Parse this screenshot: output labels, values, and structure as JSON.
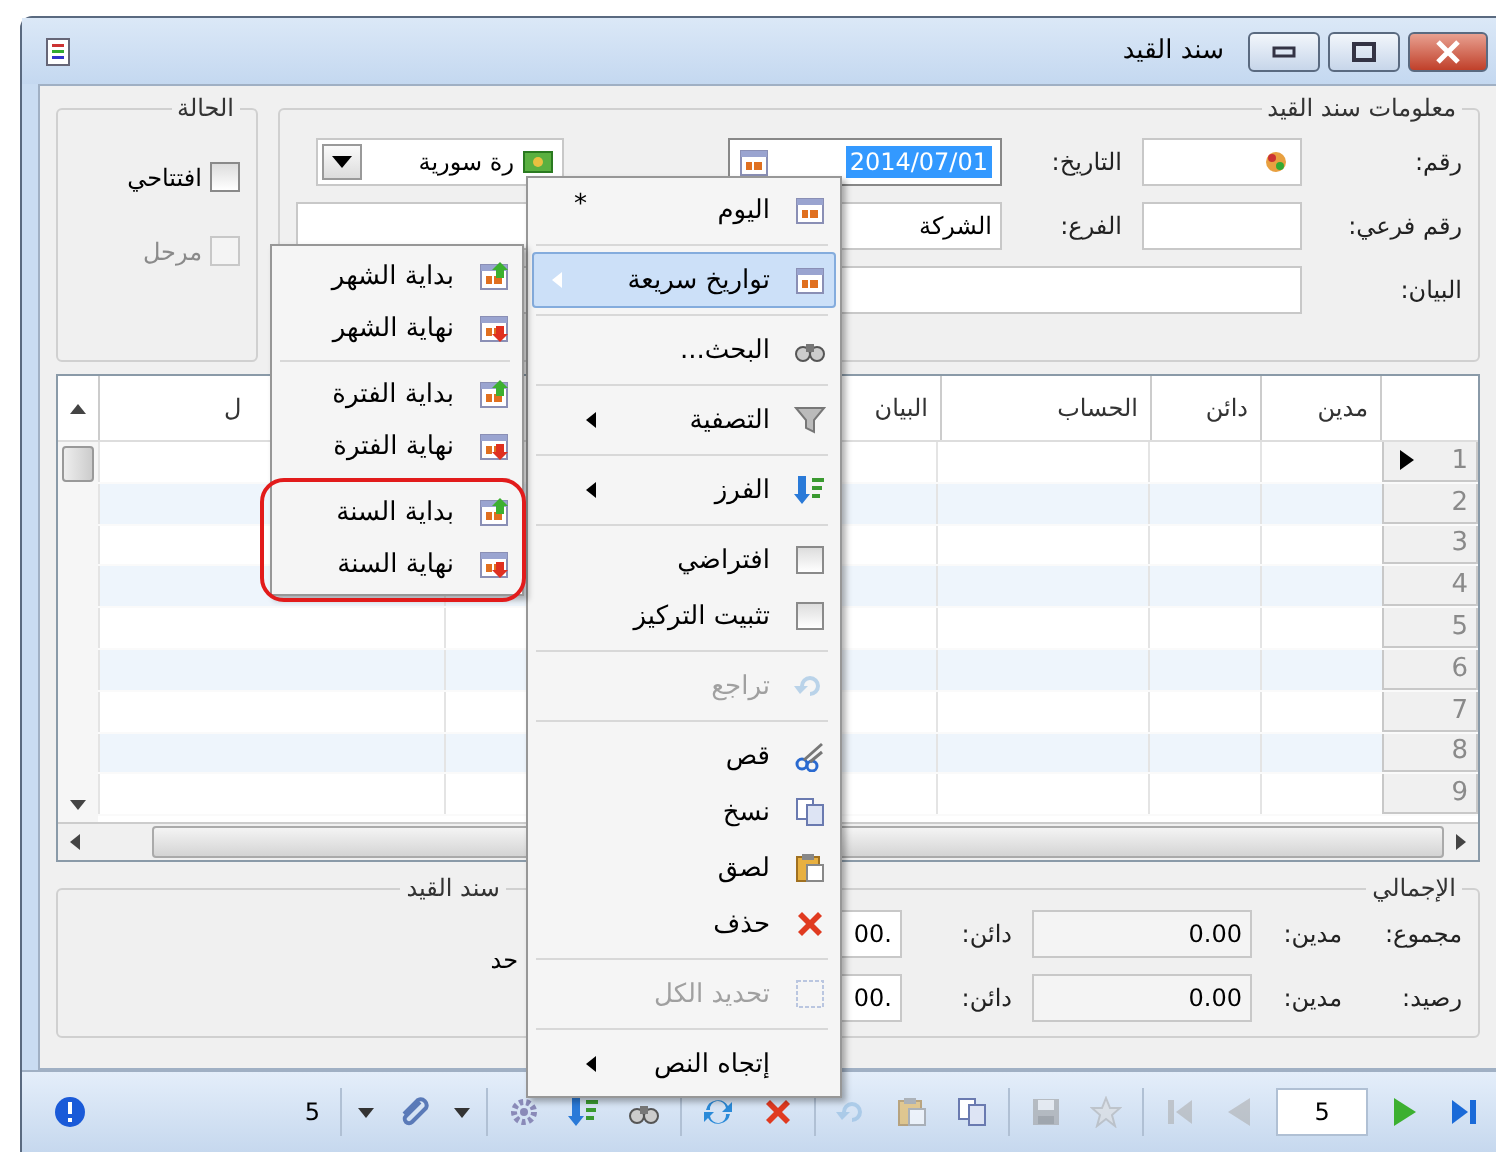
{
  "window": {
    "title": "سند القيد"
  },
  "info_group": {
    "title": "معلومات سند القيد",
    "number_label": "رقم:",
    "date_label": "التاريخ:",
    "date_value": "2014/07/01",
    "date_text_selected": true,
    "currency_value": "رة سورية",
    "sub_number_label": "رقم فرعي:",
    "branch_label": "الفرع:",
    "branch_value": "الشركة",
    "description_label": "البيان:"
  },
  "status_group": {
    "title": "الحالة",
    "checkboxes": [
      {
        "label": "افتتاحي",
        "checked": false,
        "disabled": false
      },
      {
        "label": "مرحل",
        "checked": false,
        "disabled": true
      }
    ]
  },
  "grid": {
    "columns": [
      {
        "label": "مدين"
      },
      {
        "label": "دائن"
      },
      {
        "label": "الحساب"
      },
      {
        "label": "البيان"
      },
      {},
      {
        "label": "ل"
      }
    ],
    "rows": [
      {
        "number": "1",
        "current": true
      },
      {
        "number": "2",
        "current": false
      },
      {
        "number": "3",
        "current": false
      },
      {
        "number": "4",
        "current": false
      },
      {
        "number": "5",
        "current": false
      },
      {
        "number": "6",
        "current": false
      },
      {
        "number": "7",
        "current": false
      },
      {
        "number": "8",
        "current": false
      },
      {
        "number": "9",
        "current": false
      }
    ]
  },
  "totals_group": {
    "title": "الإجمالي",
    "rows": [
      {
        "label": "مجموع:",
        "debit_label": "مدين:",
        "debit_value": "0.00",
        "credit_label": "دائن:",
        "credit_value": ".00"
      },
      {
        "label": "رصيد:",
        "debit_label": "مدين:",
        "debit_value": "0.00",
        "credit_label": "دائن:",
        "credit_value": ".00"
      }
    ]
  },
  "notes_group": {
    "title": "سند القيد",
    "text": "حد"
  },
  "toolbar": {
    "items": [
      {
        "kind": "last",
        "disabled": false
      },
      {
        "kind": "next",
        "disabled": false
      },
      {
        "kind": "page",
        "value": "5"
      },
      {
        "kind": "previous",
        "disabled": true
      },
      {
        "kind": "first",
        "disabled": true
      },
      {
        "kind": "favorite",
        "disabled": true
      },
      {
        "kind": "save",
        "disabled": true
      },
      {
        "kind": "copy",
        "disabled": false
      },
      {
        "kind": "paste",
        "disabled": true
      },
      {
        "kind": "undo",
        "disabled": true
      },
      {
        "kind": "delete",
        "disabled": false
      },
      {
        "kind": "refresh",
        "disabled": false
      },
      {
        "kind": "search",
        "disabled": false
      },
      {
        "kind": "sort",
        "disabled": false
      },
      {
        "kind": "settings",
        "disabled": false
      },
      {
        "kind": "dropdown",
        "disabled": false
      },
      {
        "kind": "attach",
        "disabled": false
      },
      {
        "kind": "dropdown",
        "disabled": false
      },
      {
        "kind": "count",
        "value": "5"
      },
      {
        "kind": "info",
        "disabled": false
      }
    ]
  },
  "context_menu": {
    "sections": [
      [
        {
          "kind": "command",
          "label": "اليوم",
          "shortcut": "*",
          "submenu": false,
          "selected": false,
          "disabled": false
        }
      ],
      [
        {
          "kind": "command",
          "label": "تواريخ سريعة",
          "submenu": true,
          "selected": true,
          "disabled": false
        }
      ],
      [
        {
          "kind": "command",
          "label": "البحث...",
          "submenu": false,
          "selected": false,
          "disabled": false
        }
      ],
      [
        {
          "kind": "command",
          "label": "التصفية",
          "submenu": true,
          "selected": false,
          "disabled": false
        }
      ],
      [
        {
          "kind": "command",
          "label": "الفرز",
          "submenu": true,
          "selected": false,
          "disabled": false
        }
      ],
      [
        {
          "kind": "checkbox",
          "label": "افتراضي",
          "checked": false,
          "selected": false,
          "disabled": false
        },
        {
          "kind": "checkbox",
          "label": "تثبيت التركيز",
          "checked": false,
          "selected": false,
          "disabled": false
        }
      ],
      [
        {
          "kind": "command",
          "label": "تراجع",
          "submenu": false,
          "selected": false,
          "disabled": true
        }
      ],
      [
        {
          "kind": "command",
          "label": "قص",
          "submenu": false,
          "selected": false,
          "disabled": false
        },
        {
          "kind": "command",
          "label": "نسخ",
          "submenu": false,
          "selected": false,
          "disabled": false
        },
        {
          "kind": "command",
          "label": "لصق",
          "submenu": false,
          "selected": false,
          "disabled": false
        },
        {
          "kind": "command",
          "label": "حذف",
          "submenu": false,
          "selected": false,
          "disabled": false
        }
      ],
      [
        {
          "kind": "command",
          "label": "تحديد الكل",
          "submenu": false,
          "selected": false,
          "disabled": true
        }
      ],
      [
        {
          "kind": "command",
          "label": "إتجاه النص",
          "submenu": true,
          "selected": false,
          "disabled": false
        }
      ]
    ]
  },
  "submenu": {
    "sections": [
      {
        "annotated": false,
        "items": [
          {
            "label": "بداية الشهر"
          },
          {
            "label": "نهاية الشهر"
          }
        ]
      },
      {
        "annotated": false,
        "items": [
          {
            "label": "بداية الفترة"
          },
          {
            "label": "نهاية الفترة"
          }
        ]
      },
      {
        "annotated": true,
        "items": [
          {
            "label": "بداية السنة"
          },
          {
            "label": "نهاية السنة"
          }
        ]
      }
    ]
  }
}
